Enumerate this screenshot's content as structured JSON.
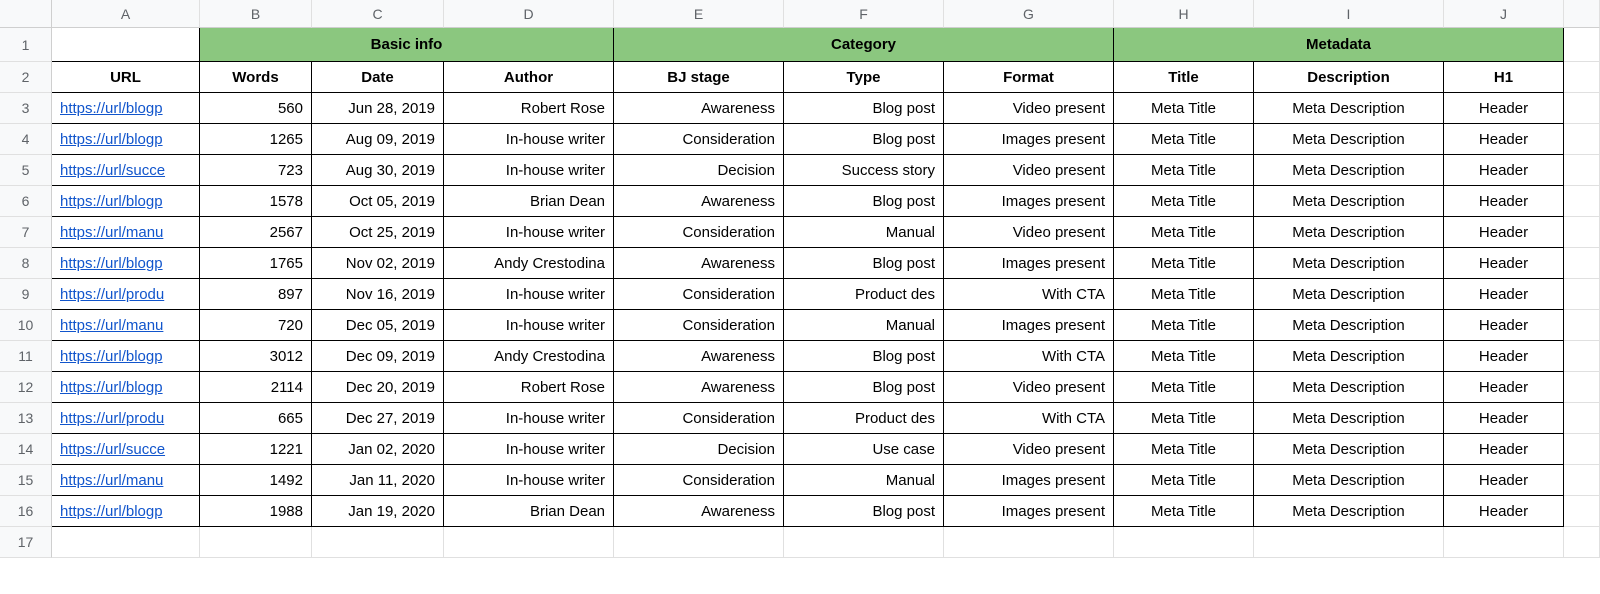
{
  "columns": [
    "A",
    "B",
    "C",
    "D",
    "E",
    "F",
    "G",
    "H",
    "I",
    "J"
  ],
  "row_numbers": [
    1,
    2,
    3,
    4,
    5,
    6,
    7,
    8,
    9,
    10,
    11,
    12,
    13,
    14,
    15,
    16,
    17
  ],
  "header_groups": {
    "basic_info": "Basic info",
    "category": "Category",
    "metadata": "Metadata"
  },
  "headers": {
    "url": "URL",
    "words": "Words",
    "date": "Date",
    "author": "Author",
    "bj_stage": "BJ stage",
    "type": "Type",
    "format": "Format",
    "title": "Title",
    "description": "Description",
    "h1": "H1"
  },
  "rows": [
    {
      "url": "https://url/blogp",
      "words": "560",
      "date": "Jun 28, 2019",
      "author": "Robert Rose",
      "bj": "Awareness",
      "type": "Blog post",
      "format": "Video present",
      "title": "Meta Title",
      "desc": "Meta Description",
      "h1": "Header"
    },
    {
      "url": "https://url/blogp",
      "words": "1265",
      "date": "Aug 09, 2019",
      "author": "In-house writer",
      "bj": "Consideration",
      "type": "Blog post",
      "format": "Images present",
      "title": "Meta Title",
      "desc": "Meta Description",
      "h1": "Header"
    },
    {
      "url": "https://url/succe",
      "words": "723",
      "date": "Aug 30, 2019",
      "author": "In-house writer",
      "bj": "Decision",
      "type": "Success story",
      "format": "Video present",
      "title": "Meta Title",
      "desc": "Meta Description",
      "h1": "Header"
    },
    {
      "url": "https://url/blogp",
      "words": "1578",
      "date": "Oct 05, 2019",
      "author": "Brian Dean",
      "bj": "Awareness",
      "type": "Blog post",
      "format": "Images present",
      "title": "Meta Title",
      "desc": "Meta Description",
      "h1": "Header"
    },
    {
      "url": "https://url/manu",
      "words": "2567",
      "date": "Oct 25, 2019",
      "author": "In-house writer",
      "bj": "Consideration",
      "type": "Manual",
      "format": "Video present",
      "title": "Meta Title",
      "desc": "Meta Description",
      "h1": "Header"
    },
    {
      "url": "https://url/blogp",
      "words": "1765",
      "date": "Nov 02, 2019",
      "author": "Andy Crestodina",
      "bj": "Awareness",
      "type": "Blog post",
      "format": "Images present",
      "title": "Meta Title",
      "desc": "Meta Description",
      "h1": "Header"
    },
    {
      "url": "https://url/produ",
      "words": "897",
      "date": "Nov 16, 2019",
      "author": "In-house writer",
      "bj": "Consideration",
      "type": "Product des",
      "format": "With CTA",
      "title": "Meta Title",
      "desc": "Meta Description",
      "h1": "Header"
    },
    {
      "url": "https://url/manu",
      "words": "720",
      "date": "Dec 05, 2019",
      "author": "In-house writer",
      "bj": "Consideration",
      "type": "Manual",
      "format": "Images present",
      "title": "Meta Title",
      "desc": "Meta Description",
      "h1": "Header"
    },
    {
      "url": "https://url/blogp",
      "words": "3012",
      "date": "Dec 09, 2019",
      "author": "Andy Crestodina",
      "bj": "Awareness",
      "type": "Blog post",
      "format": "With CTA",
      "title": "Meta Title",
      "desc": "Meta Description",
      "h1": "Header"
    },
    {
      "url": "https://url/blogp",
      "words": "2114",
      "date": "Dec 20, 2019",
      "author": "Robert Rose",
      "bj": "Awareness",
      "type": "Blog post",
      "format": "Video present",
      "title": "Meta Title",
      "desc": "Meta Description",
      "h1": "Header"
    },
    {
      "url": "https://url/produ",
      "words": "665",
      "date": "Dec 27, 2019",
      "author": "In-house writer",
      "bj": "Consideration",
      "type": "Product des",
      "format": "With CTA",
      "title": "Meta Title",
      "desc": "Meta Description",
      "h1": "Header"
    },
    {
      "url": "https://url/succe",
      "words": "1221",
      "date": "Jan 02, 2020",
      "author": "In-house writer",
      "bj": "Decision",
      "type": "Use case",
      "format": "Video present",
      "title": "Meta Title",
      "desc": "Meta Description",
      "h1": "Header"
    },
    {
      "url": "https://url/manu",
      "words": "1492",
      "date": "Jan 11, 2020",
      "author": "In-house writer",
      "bj": "Consideration",
      "type": "Manual",
      "format": "Images present",
      "title": "Meta Title",
      "desc": "Meta Description",
      "h1": "Header"
    },
    {
      "url": "https://url/blogp",
      "words": "1988",
      "date": "Jan 19, 2020",
      "author": "Brian Dean",
      "bj": "Awareness",
      "type": "Blog post",
      "format": "Images present",
      "title": "Meta Title",
      "desc": "Meta Description",
      "h1": "Header"
    }
  ]
}
